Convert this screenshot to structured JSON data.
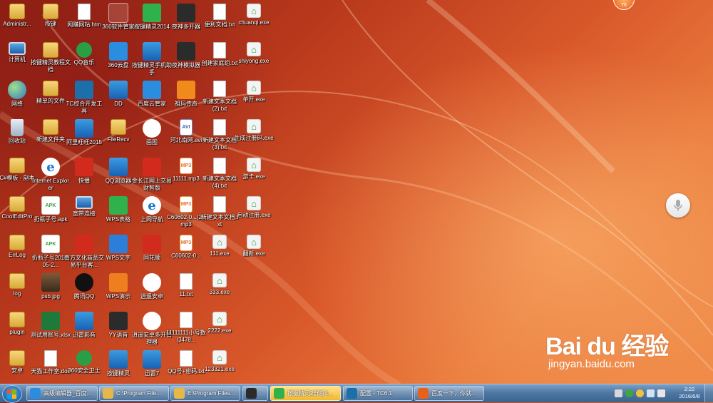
{
  "desktop": {
    "icons": [
      {
        "label": "Administr...",
        "icon": "user-folder-icon",
        "cls": "g-folder",
        "col": 0,
        "row": 0
      },
      {
        "label": "计算机",
        "icon": "computer-icon",
        "cls": "g-pc",
        "col": 0,
        "row": 1
      },
      {
        "label": "网络",
        "icon": "network-icon",
        "cls": "g-globe",
        "col": 0,
        "row": 2
      },
      {
        "label": "回收站",
        "icon": "recycle-bin-icon",
        "cls": "g-bin",
        "col": 0,
        "row": 3
      },
      {
        "label": "C#模板 - 副本",
        "icon": "folder-icon",
        "cls": "g-folder",
        "col": 0,
        "row": 4
      },
      {
        "label": "CoolEditPro",
        "icon": "folder-icon",
        "cls": "g-folder",
        "col": 0,
        "row": 5
      },
      {
        "label": "ErrLog",
        "icon": "folder-icon",
        "cls": "g-folder",
        "col": 0,
        "row": 6
      },
      {
        "label": "log",
        "icon": "folder-icon",
        "cls": "g-folder",
        "col": 0,
        "row": 7
      },
      {
        "label": "plugin",
        "icon": "folder-icon",
        "cls": "g-folder",
        "col": 0,
        "row": 8
      },
      {
        "label": "安卓",
        "icon": "folder-icon",
        "cls": "g-folder",
        "col": 0,
        "row": 9
      },
      {
        "label": "按键",
        "icon": "folder-icon",
        "cls": "g-folder",
        "col": 1,
        "row": 0
      },
      {
        "label": "按键精灵教程文档",
        "icon": "folder-icon",
        "cls": "g-folder",
        "col": 1,
        "row": 1
      },
      {
        "label": "精单的文件",
        "icon": "folder-icon",
        "cls": "g-folder",
        "col": 1,
        "row": 2
      },
      {
        "label": "新建文件夹",
        "icon": "folder-icon",
        "cls": "g-folder",
        "col": 1,
        "row": 3
      },
      {
        "label": "Internet Explorer",
        "icon": "internet-explorer-icon",
        "cls": "g-ie",
        "col": 1,
        "row": 4
      },
      {
        "label": "扔瓶子号.apk",
        "icon": "apk-icon",
        "cls": "g-apk",
        "col": 1,
        "row": 5
      },
      {
        "label": "扔瓶子号2016-05-2...",
        "icon": "apk-icon",
        "cls": "g-apk",
        "col": 1,
        "row": 6
      },
      {
        "label": "psb.jpg",
        "icon": "image-icon",
        "cls": "g-photo",
        "col": 1,
        "row": 7
      },
      {
        "label": "测试用账号.xlsx",
        "icon": "excel-icon",
        "cls": "g-xls",
        "col": 1,
        "row": 8
      },
      {
        "label": "天猫工作室.doc",
        "icon": "word-doc-icon",
        "cls": "g-doc",
        "col": 1,
        "row": 9
      },
      {
        "label": "网赚网站.htm",
        "icon": "web-page-icon",
        "cls": "g-doc",
        "col": 2,
        "row": 0
      },
      {
        "label": "QQ音乐",
        "icon": "qq-music-icon",
        "cls": "g-green",
        "col": 2,
        "row": 1
      },
      {
        "label": "TC综合开发工具",
        "icon": "tc-dev-tool-icon",
        "cls": "g-teal",
        "col": 2,
        "row": 2
      },
      {
        "label": "阿里旺旺2015",
        "icon": "aliwangwang-icon",
        "cls": "g-blue",
        "col": 2,
        "row": 3
      },
      {
        "label": "快播",
        "icon": "qvod-icon",
        "cls": "g-red",
        "col": 2,
        "row": 4
      },
      {
        "label": "宽带连接",
        "icon": "broadband-connection-icon",
        "cls": "g-pc",
        "col": 2,
        "row": 5
      },
      {
        "label": "南方文化商品交易平台客...",
        "icon": "trading-platform-icon",
        "cls": "g-red",
        "col": 2,
        "row": 6
      },
      {
        "label": "腾讯QQ",
        "icon": "qq-penguin-icon",
        "cls": "g-qq",
        "col": 2,
        "row": 7
      },
      {
        "label": "迅雷影音",
        "icon": "xunlei-player-icon",
        "cls": "g-blue",
        "col": 2,
        "row": 8
      },
      {
        "label": "360安全卫士",
        "icon": "360-security-icon",
        "cls": "g-green",
        "col": 2,
        "row": 9
      },
      {
        "label": "360软件管家",
        "icon": "360-software-manager-icon",
        "cls": "g-red",
        "col": 3,
        "row": 0,
        "selected": true
      },
      {
        "label": "360云盘",
        "icon": "360-cloud-icon",
        "cls": "g-cloud",
        "col": 3,
        "row": 1
      },
      {
        "label": "DD",
        "icon": "dd-icon",
        "cls": "g-blue",
        "col": 3,
        "row": 2
      },
      {
        "label": "FileRecv",
        "icon": "folder-icon",
        "cls": "g-folder",
        "col": 3,
        "row": 3
      },
      {
        "label": "QQ浏览器",
        "icon": "qq-browser-icon",
        "cls": "g-blue",
        "col": 3,
        "row": 4
      },
      {
        "label": "WPS表格",
        "icon": "wps-spreadsheet-icon",
        "cls": "g-wpsg",
        "col": 3,
        "row": 5
      },
      {
        "label": "WPS文字",
        "icon": "wps-writer-icon",
        "cls": "g-wpsb",
        "col": 3,
        "row": 6
      },
      {
        "label": "WPS演示",
        "icon": "wps-presentation-icon",
        "cls": "g-wpso",
        "col": 3,
        "row": 7
      },
      {
        "label": "YY语音",
        "icon": "yy-voice-icon",
        "cls": "g-dark",
        "col": 3,
        "row": 8
      },
      {
        "label": "按键精灵",
        "icon": "anjian-jingling-icon",
        "cls": "g-blue",
        "col": 3,
        "row": 9
      },
      {
        "label": "按键精灵2014",
        "icon": "anjian-jingling-icon",
        "cls": "g-wpsg",
        "col": 4,
        "row": 0
      },
      {
        "label": "按键精灵手机助手",
        "icon": "anjian-mobile-icon",
        "cls": "g-blue",
        "col": 4,
        "row": 1
      },
      {
        "label": "百度云管家",
        "icon": "baidu-cloud-icon",
        "cls": "g-cloud",
        "col": 4,
        "row": 2
      },
      {
        "label": "画图",
        "icon": "paint-icon",
        "cls": "g-flower",
        "col": 4,
        "row": 3
      },
      {
        "label": "金长江网上交易财智版",
        "icon": "trading-app-icon",
        "cls": "g-red",
        "col": 4,
        "row": 4
      },
      {
        "label": "上网导航",
        "icon": "web-navigation-icon",
        "cls": "g-ie",
        "col": 4,
        "row": 5
      },
      {
        "label": "同花顺",
        "icon": "tonghuashun-icon",
        "cls": "g-red",
        "col": 4,
        "row": 6
      },
      {
        "label": "逍遥安卓",
        "icon": "xiaoyao-android-icon",
        "cls": "g-flower",
        "col": 4,
        "row": 7
      },
      {
        "label": "逍遥安卓多开管理器",
        "icon": "xiaoyao-multi-icon",
        "cls": "g-flower",
        "col": 4,
        "row": 8
      },
      {
        "label": "迅雷7",
        "icon": "xunlei-icon",
        "cls": "g-blue",
        "col": 4,
        "row": 9
      },
      {
        "label": "夜神多开器",
        "icon": "nox-multi-icon",
        "cls": "g-dark",
        "col": 5,
        "row": 0
      },
      {
        "label": "夜神模拟器",
        "icon": "nox-emulator-icon",
        "cls": "g-dark",
        "col": 5,
        "row": 1
      },
      {
        "label": "祖玛传奇",
        "icon": "zuma-game-icon",
        "cls": "g-orange",
        "col": 5,
        "row": 2
      },
      {
        "label": "河北南网.avi",
        "icon": "avi-video-icon",
        "cls": "g-avi",
        "col": 5,
        "row": 3
      },
      {
        "label": "11111.mp3",
        "icon": "mp3-icon",
        "cls": "g-mp3",
        "col": 5,
        "row": 4
      },
      {
        "label": "C60602-0...(2).mp3",
        "icon": "mp3-icon",
        "cls": "g-mp3",
        "col": 5,
        "row": 5
      },
      {
        "label": "C60602-0...",
        "icon": "mp3-icon",
        "cls": "g-mp3",
        "col": 5,
        "row": 6
      },
      {
        "label": "11.txt",
        "icon": "text-file-icon",
        "cls": "g-doc",
        "col": 5,
        "row": 7
      },
      {
        "label": "11111111小号数(3478...",
        "icon": "text-file-icon",
        "cls": "g-doc",
        "col": 5,
        "row": 8
      },
      {
        "label": "QQ号+密码.txt",
        "icon": "text-file-icon",
        "cls": "g-doc",
        "col": 5,
        "row": 9
      },
      {
        "label": "便利文档.txt",
        "icon": "text-file-icon",
        "cls": "g-doc",
        "col": 6,
        "row": 0
      },
      {
        "label": "创建家庭组.txt",
        "icon": "text-file-icon",
        "cls": "g-doc",
        "col": 6,
        "row": 1
      },
      {
        "label": "新建文本文档(2).txt",
        "icon": "text-file-icon",
        "cls": "g-doc",
        "col": 6,
        "row": 2
      },
      {
        "label": "新建文本文档(3).txt",
        "icon": "text-file-icon",
        "cls": "g-doc",
        "col": 6,
        "row": 3
      },
      {
        "label": "新建文本文档(4).txt",
        "icon": "text-file-icon",
        "cls": "g-doc",
        "col": 6,
        "row": 4
      },
      {
        "label": "新建文本文档.txt",
        "icon": "text-file-icon",
        "cls": "g-doc",
        "col": 6,
        "row": 5
      },
      {
        "label": "111.exe",
        "icon": "exe-icon",
        "cls": "g-exe",
        "col": 6,
        "row": 6
      },
      {
        "label": "333.exe",
        "icon": "exe-icon",
        "cls": "g-exe",
        "col": 6,
        "row": 7
      },
      {
        "label": "2222.exe",
        "icon": "exe-icon",
        "cls": "g-exe",
        "col": 6,
        "row": 8
      },
      {
        "label": "123321.exe",
        "icon": "exe-icon",
        "cls": "g-exe",
        "col": 6,
        "row": 9
      },
      {
        "label": "chuanqi.exe",
        "icon": "exe-icon",
        "cls": "g-exe",
        "col": 7,
        "row": 0
      },
      {
        "label": "shiyong.exe",
        "icon": "exe-icon",
        "cls": "g-exe",
        "col": 7,
        "row": 1
      },
      {
        "label": "单开.exe",
        "icon": "exe-icon",
        "cls": "g-exe",
        "col": 7,
        "row": 2
      },
      {
        "label": "生成注册码.exe",
        "icon": "exe-icon",
        "cls": "g-exe",
        "col": 7,
        "row": 3
      },
      {
        "label": "游卡.exe",
        "icon": "exe-icon",
        "cls": "g-exe",
        "col": 7,
        "row": 4
      },
      {
        "label": "启动注册.exe",
        "icon": "exe-icon",
        "cls": "g-exe",
        "col": 7,
        "row": 5
      },
      {
        "label": "翻新.exe",
        "icon": "exe-icon",
        "cls": "g-exe",
        "col": 7,
        "row": 6
      }
    ]
  },
  "widgets": {
    "badge_value": "76",
    "mic_icon": "microphone-icon"
  },
  "watermark": {
    "brand": "Bai du 经验",
    "url": "jingyan.baidu.com"
  },
  "taskbar": {
    "tasks": [
      {
        "label": "高级编辑器_百度...",
        "icon": "qq-browser-icon",
        "color": "#2b8de0",
        "active": false
      },
      {
        "label": "C:\\Program File...",
        "icon": "folder-icon",
        "color": "#e6b84a",
        "active": false
      },
      {
        "label": "E:\\Program Files...",
        "icon": "folder-icon",
        "color": "#e6b84a",
        "active": false
      },
      {
        "label": "",
        "icon": "nox-app-icon",
        "color": "#2b2b2b",
        "active": false
      },
      {
        "label": "按键精灵2群哪4...",
        "icon": "anjian-jingling-icon",
        "color": "#2fb24c",
        "active": true
      },
      {
        "label": "配置 - TC6.1",
        "icon": "tc-dev-tool-icon",
        "color": "#1c6fa8",
        "active": false
      },
      {
        "label": "百度一下，你就...",
        "icon": "firefox-icon",
        "color": "#e8601c",
        "active": false
      }
    ],
    "clock_time": "2:22",
    "clock_date": "2016/6/8"
  }
}
